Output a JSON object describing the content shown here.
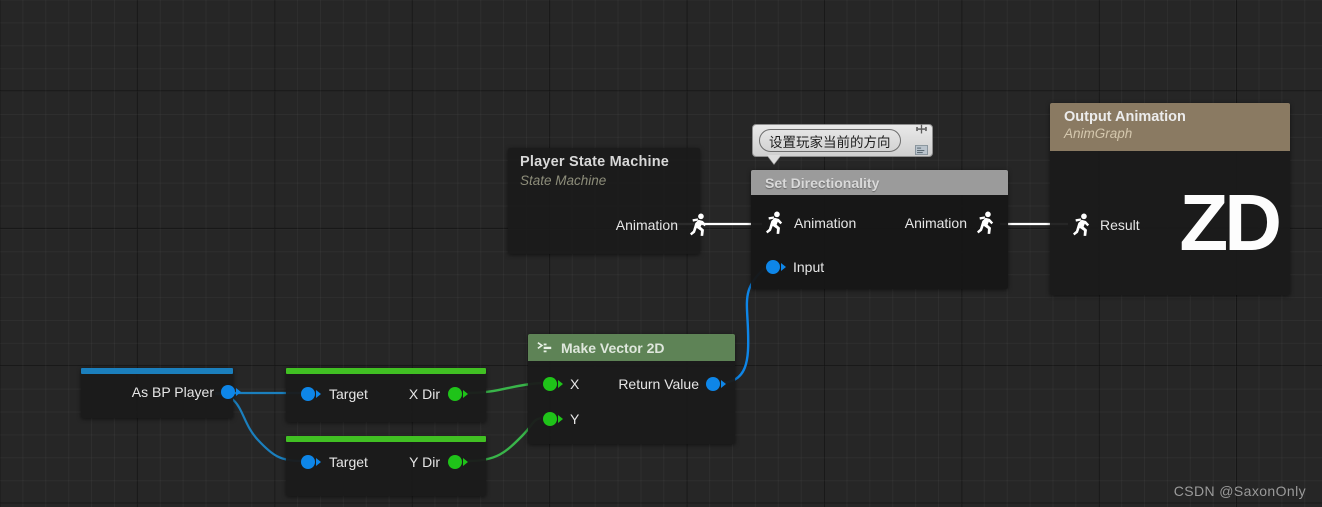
{
  "app": {
    "editor": "Unreal Engine Blueprint AnimGraph",
    "watermark": "CSDN @SaxonOnly"
  },
  "colors": {
    "canvas_bg": "#262626",
    "grid_minor": "rgba(255,255,255,0.035)",
    "grid_major": "rgba(0,0,0,0.55)",
    "exec_pose_wire": "#ffffff",
    "object_wire": "#1b7fbd",
    "float_wire": "#39b54a",
    "struct_wire": "#0e86e8",
    "node_body": "#1a1a1a",
    "set_directionality_header": "#9b9b9b",
    "output_animation_header": "#8a7a62",
    "make_vector_header": "#5e8356",
    "pin_blue": "#0e86e8",
    "pin_green": "#1fc319",
    "cap_blue": "#1b7fbd",
    "cap_green": "#41c023"
  },
  "comment_bubble": {
    "text": "设置玩家当前的方向",
    "pin_icon": "pushpin-icon",
    "note_icon": "note-icon"
  },
  "nodes": {
    "state_machine": {
      "title": "Player State Machine",
      "subtitle": "State Machine",
      "output_pins": [
        {
          "label": "Animation",
          "icon": "pose-pin-icon",
          "type": "pose"
        }
      ]
    },
    "set_directionality": {
      "title": "Set Directionality",
      "input_pins": [
        {
          "label": "Animation",
          "icon": "pose-pin-icon",
          "type": "pose"
        },
        {
          "label": "Input",
          "icon": "data-pin-icon",
          "type": "struct"
        }
      ],
      "output_pins": [
        {
          "label": "Animation",
          "icon": "pose-pin-icon",
          "type": "pose"
        }
      ]
    },
    "output_animation": {
      "title": "Output Animation",
      "subtitle": "AnimGraph",
      "input_pins": [
        {
          "label": "Result",
          "icon": "pose-pin-icon",
          "type": "pose"
        }
      ],
      "logo": "ZD"
    },
    "make_vector_2d": {
      "title": "Make Vector 2D",
      "icon": "make-struct-icon",
      "input_pins": [
        {
          "label": "X",
          "type": "float"
        },
        {
          "label": "Y",
          "type": "float"
        }
      ],
      "output_pins": [
        {
          "label": "Return Value",
          "type": "struct"
        }
      ]
    },
    "as_bp_player": {
      "output_pins": [
        {
          "label": "As BP Player",
          "type": "object"
        }
      ]
    },
    "x_dir": {
      "input_pins": [
        {
          "label": "Target",
          "type": "object"
        }
      ],
      "output_pins": [
        {
          "label": "X Dir",
          "type": "float"
        }
      ]
    },
    "y_dir": {
      "input_pins": [
        {
          "label": "Target",
          "type": "object"
        }
      ],
      "output_pins": [
        {
          "label": "Y Dir",
          "type": "float"
        }
      ]
    }
  }
}
